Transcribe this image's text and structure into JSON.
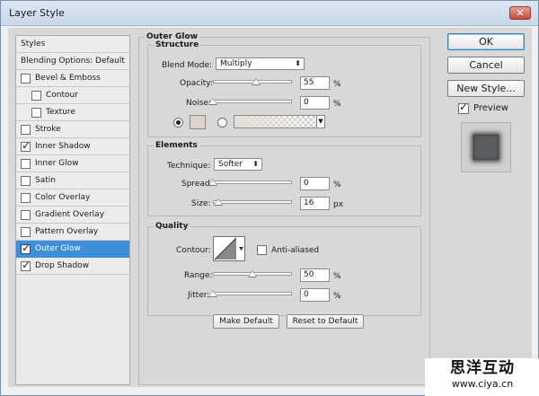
{
  "window": {
    "title": "Layer Style",
    "close_glyph": "✕"
  },
  "style_list": {
    "items": [
      {
        "label": "Styles",
        "type": "header",
        "checked": false
      },
      {
        "label": "Blending Options: Default",
        "type": "header",
        "checked": false
      },
      {
        "label": "Bevel & Emboss",
        "type": "item",
        "checked": false
      },
      {
        "label": "Contour",
        "type": "sub",
        "checked": false
      },
      {
        "label": "Texture",
        "type": "sub",
        "checked": false
      },
      {
        "label": "Stroke",
        "type": "item",
        "checked": false
      },
      {
        "label": "Inner Shadow",
        "type": "item",
        "checked": true
      },
      {
        "label": "Inner Glow",
        "type": "item",
        "checked": false
      },
      {
        "label": "Satin",
        "type": "item",
        "checked": false
      },
      {
        "label": "Color Overlay",
        "type": "item",
        "checked": false
      },
      {
        "label": "Gradient Overlay",
        "type": "item",
        "checked": false
      },
      {
        "label": "Pattern Overlay",
        "type": "item",
        "checked": false
      },
      {
        "label": "Outer Glow",
        "type": "item",
        "checked": true,
        "selected": true
      },
      {
        "label": "Drop Shadow",
        "type": "item",
        "checked": true
      }
    ]
  },
  "outer_glow": {
    "title": "Outer Glow",
    "structure": {
      "title": "Structure",
      "blend_mode_label": "Blend Mode:",
      "blend_mode_value": "Multiply",
      "opacity_label": "Opacity:",
      "opacity_value": "55",
      "opacity_level": 0.55,
      "noise_label": "Noise:",
      "noise_value": "0",
      "noise_level": 0,
      "percent": "%"
    },
    "elements": {
      "title": "Elements",
      "technique_label": "Technique:",
      "technique_value": "Softer",
      "spread_label": "Spread:",
      "spread_value": "0",
      "spread_level": 0,
      "size_label": "Size:",
      "size_value": "16",
      "size_level": 0.07,
      "percent": "%",
      "px": "px"
    },
    "quality": {
      "title": "Quality",
      "contour_label": "Contour:",
      "anti_aliased_label": "Anti-aliased",
      "range_label": "Range:",
      "range_value": "50",
      "range_level": 0.5,
      "jitter_label": "Jitter:",
      "jitter_value": "0",
      "jitter_level": 0,
      "percent": "%"
    },
    "make_default_label": "Make Default",
    "reset_default_label": "Reset to Default"
  },
  "actions": {
    "ok_label": "OK",
    "cancel_label": "Cancel",
    "new_style_label": "New Style...",
    "preview_label": "Preview",
    "preview_checked": true
  },
  "watermark": {
    "chinese": "思洋互动",
    "url": "www.ciya.cn"
  }
}
